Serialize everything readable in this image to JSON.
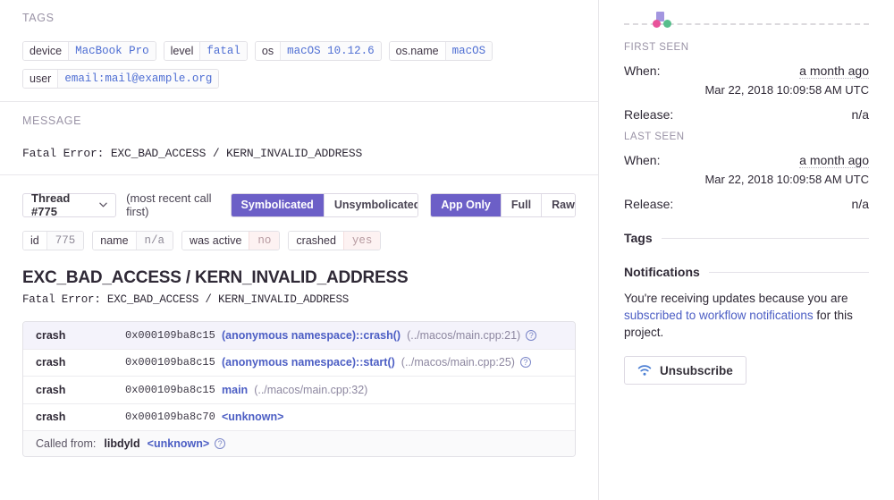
{
  "tags_section": {
    "label": "TAGS",
    "rows": [
      [
        {
          "key": "device",
          "value": "MacBook Pro"
        },
        {
          "key": "level",
          "value": "fatal"
        },
        {
          "key": "os",
          "value": "macOS 10.12.6"
        },
        {
          "key": "os.name",
          "value": "macOS"
        }
      ],
      [
        {
          "key": "user",
          "value": "email:mail@example.org"
        }
      ]
    ]
  },
  "message_section": {
    "label": "MESSAGE",
    "text": "Fatal Error: EXC_BAD_ACCESS / KERN_INVALID_ADDRESS"
  },
  "controls": {
    "thread_label": "Thread #775",
    "chevron": "⌄",
    "hint": "(most recent call first)",
    "symbolication": [
      {
        "label": "Symbolicated",
        "active": true
      },
      {
        "label": "Unsymbolicated",
        "active": false
      }
    ],
    "detail": [
      {
        "label": "App Only",
        "active": true
      },
      {
        "label": "Full",
        "active": false
      },
      {
        "label": "Raw",
        "active": false
      }
    ],
    "accent_color": "#6c5fc7"
  },
  "thread_meta": [
    {
      "key": "id",
      "value": "775",
      "tone": "neutral"
    },
    {
      "key": "name",
      "value": "n/a",
      "tone": "neutral"
    },
    {
      "key": "was active",
      "value": "no",
      "tone": "danger"
    },
    {
      "key": "crashed",
      "value": "yes",
      "tone": "danger"
    }
  ],
  "exception": {
    "title": "EXC_BAD_ACCESS / KERN_INVALID_ADDRESS",
    "subtitle": "Fatal Error: EXC_BAD_ACCESS / KERN_INVALID_ADDRESS"
  },
  "stacktrace": {
    "frames": [
      {
        "package": "crash",
        "address": "0x000109ba8c15",
        "function": "(anonymous namespace)::crash()",
        "location": "(../macos/main.cpp:21)",
        "has_help": true,
        "highlight": true
      },
      {
        "package": "crash",
        "address": "0x000109ba8c15",
        "function": "(anonymous namespace)::start()",
        "location": "(../macos/main.cpp:25)",
        "has_help": true,
        "highlight": false
      },
      {
        "package": "crash",
        "address": "0x000109ba8c15",
        "function": "main",
        "location": "(../macos/main.cpp:32)",
        "has_help": false,
        "highlight": false
      },
      {
        "package": "crash",
        "address": "0x000109ba8c70",
        "function": "<unknown>",
        "location": "",
        "has_help": false,
        "highlight": false
      }
    ],
    "footer": {
      "label": "Called from:",
      "module": "libdyld",
      "symbol": "<unknown>",
      "has_help": true
    }
  },
  "sidebar": {
    "first_seen": {
      "label": "FIRST SEEN",
      "when_label": "When:",
      "when_value": "a month ago",
      "when_exact": "Mar 22, 2018 10:09:58 AM UTC",
      "release_label": "Release:",
      "release_value": "n/a"
    },
    "last_seen": {
      "label": "LAST SEEN",
      "when_label": "When:",
      "when_value": "a month ago",
      "when_exact": "Mar 22, 2018 10:09:58 AM UTC",
      "release_label": "Release:",
      "release_value": "n/a"
    },
    "tags_heading": "Tags",
    "notifications_heading": "Notifications",
    "notification_text_before": "You're receiving updates because you are ",
    "notification_link": "subscribed to workflow notifications",
    "notification_text_after": " for this project.",
    "unsubscribe_label": "Unsubscribe",
    "marker_colors": {
      "square": "#a396e0",
      "pink_dot": "#e8529a",
      "green_dot": "#57be8c"
    }
  }
}
